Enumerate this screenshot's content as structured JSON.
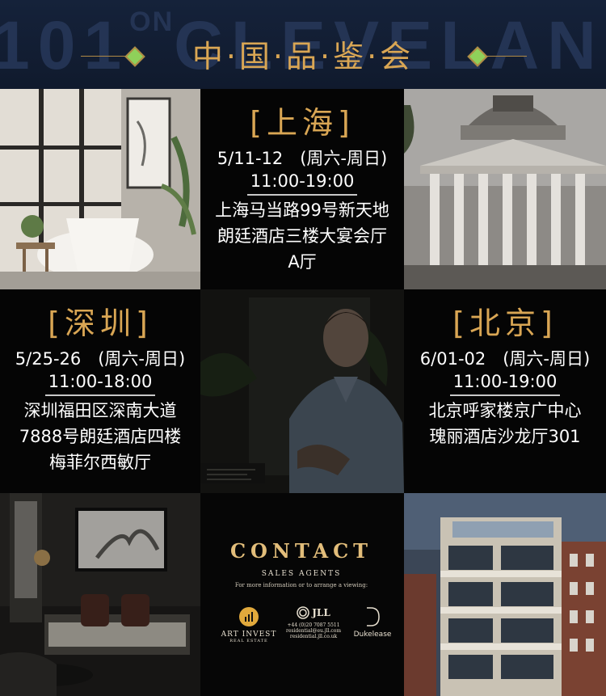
{
  "banner": {
    "background_text": "101",
    "background_on": "ON",
    "background_text2": "CLEVELAND",
    "title": "中·国·品·鉴·会",
    "accent_color": "#d9a654"
  },
  "shanghai": {
    "city": "[上海]",
    "date": "5/11-12　(周六-周日)",
    "time": "11:00-19:00",
    "address_line1": "上海马当路99号新天地",
    "address_line2": "朗廷酒店三楼大宴会厅",
    "address_line3": "A厅"
  },
  "shenzhen": {
    "city": "[深圳]",
    "date": "5/25-26　(周六-周日)",
    "time": "11:00-18:00",
    "address_line1": "深圳福田区深南大道",
    "address_line2": "7888号朗廷酒店四楼",
    "address_line3": "梅菲尔西敏厅"
  },
  "beijing": {
    "city": "[北京]",
    "date": "6/01-02　(周六-周日)",
    "time": "11:00-19:00",
    "address_line1": "北京呼家楼京广中心",
    "address_line2": "瑰丽酒店沙龙厅301"
  },
  "contact": {
    "title": "CONTACT",
    "subtitle": "SALES AGENTS",
    "note": "For more information or to arrange a viewing:",
    "logo_artinvest": "ART INVEST",
    "logo_artinvest_sub": "REAL ESTATE",
    "logo_jll": "JLL",
    "jll_phone": "+44 (0)20 7087 5511",
    "jll_email": "residential@eu.jll.com",
    "jll_web": "residential.jll.co.uk",
    "logo_dukelease": "Dukelease"
  }
}
